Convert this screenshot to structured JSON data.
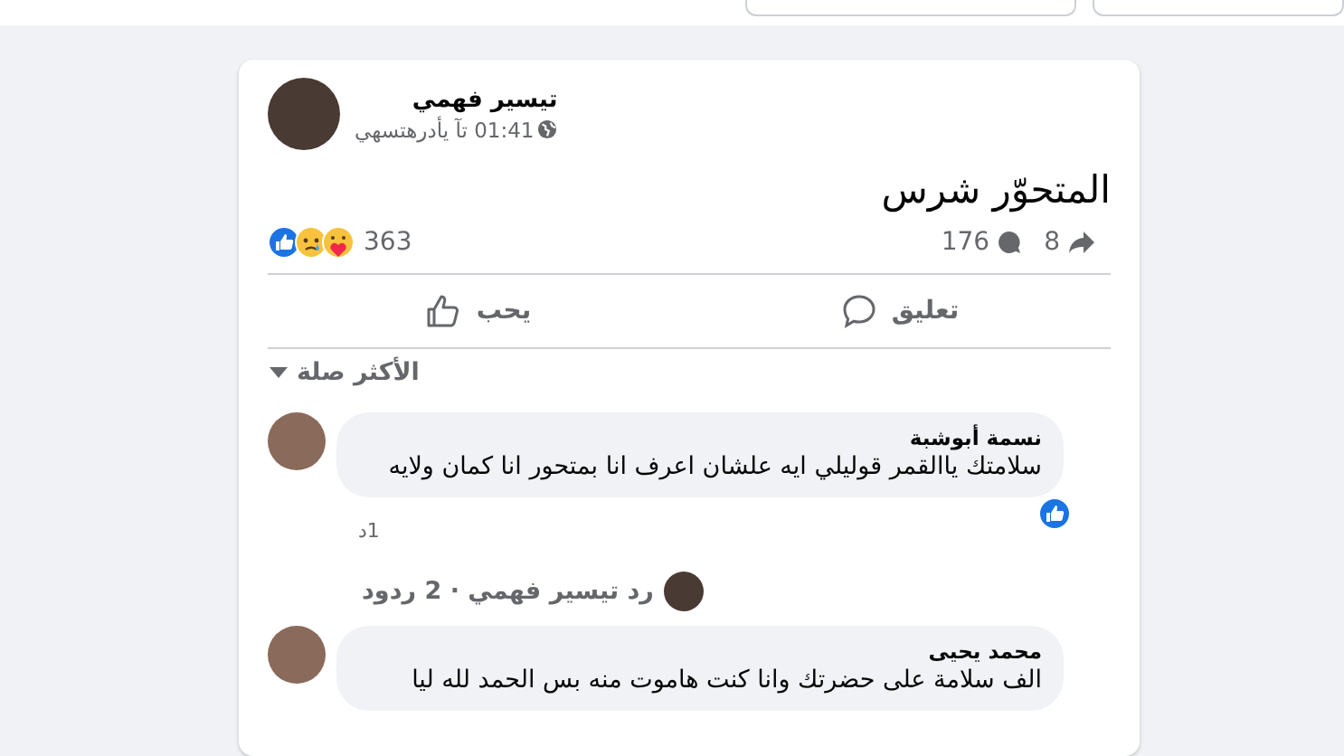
{
  "post": {
    "author": "تيسير فهمي",
    "time": "01:41 تآ يأدرهتسهي",
    "text": "المتحوّر شرس",
    "reaction_count": "363",
    "comment_count": "176",
    "share_count": "8"
  },
  "actions": [
    {
      "kind": "comment",
      "label": "تعليق"
    },
    {
      "kind": "like",
      "label": "يحب"
    }
  ],
  "sort_label": "الأكثر صلة",
  "comments": [
    {
      "author": "نسمة أبوشبة",
      "text": "سلامتك ياالقمر قوليلي ايه علشان اعرف انا بمتحور انا كمان ولايه",
      "time": "1د",
      "liked": true,
      "reply_summary": "رد تيسير فهمي · 2 ردود"
    },
    {
      "author": "محمد يحيى",
      "text": "الف سلامة على حضرتك وانا كنت هاموت منه بس الحمد لله ليا",
      "liked": false
    }
  ]
}
